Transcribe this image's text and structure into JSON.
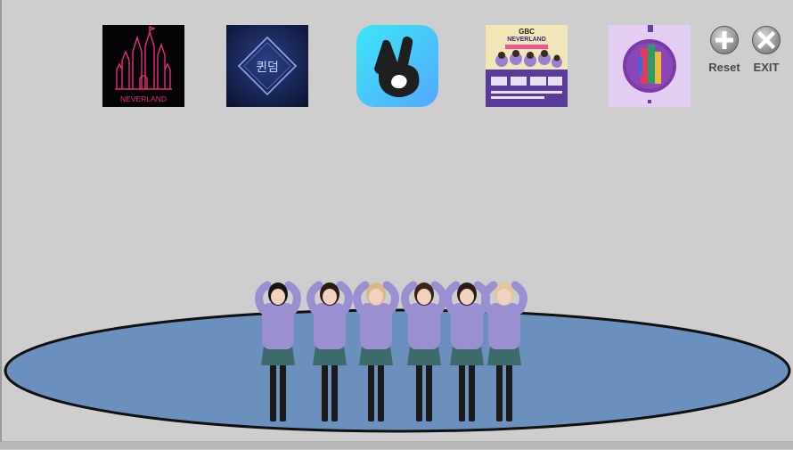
{
  "thumbnails": {
    "neverland": {
      "name": "neverland-album-thumb",
      "text": "NEVERLAND"
    },
    "queendom": {
      "name": "queendom-thumb",
      "text": "퀸덤"
    },
    "vlive": {
      "name": "vlive-thumb"
    },
    "poster": {
      "name": "neverland-poster-thumb",
      "title": "GBC",
      "subtitle": "NEVERLAND"
    },
    "album": {
      "name": "purple-album-thumb"
    }
  },
  "controls": {
    "reset_label": "Reset",
    "exit_label": "EXIT"
  },
  "colors": {
    "background": "#cecece",
    "stage_fill": "#6b90bd",
    "stage_outline": "#111111",
    "sweater": "#9a8fd0",
    "skirt": "#3d6a6a",
    "boots": "#1a1a1a",
    "vlive_bg": "#38d7ff"
  }
}
